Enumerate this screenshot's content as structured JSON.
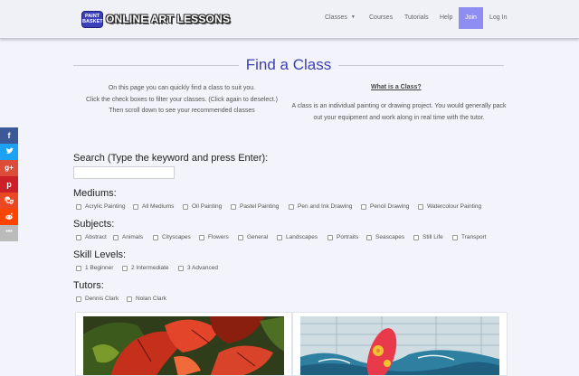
{
  "header": {
    "logo_badge": "PAINT BASKET",
    "logo_text": "ONLINE ART LESSONS",
    "nav": {
      "classes": "Classes",
      "courses": "Courses",
      "tutorials": "Tutorials",
      "help": "Help",
      "join": "Join",
      "login": "Log In"
    }
  },
  "social": [
    {
      "icon": "facebook-icon",
      "glyph": "f",
      "color": "#3b5998"
    },
    {
      "icon": "twitter-icon",
      "glyph": "t",
      "color": "#1da1f2"
    },
    {
      "icon": "google-plus-icon",
      "glyph": "g+",
      "color": "#dd4b39"
    },
    {
      "icon": "pinterest-icon",
      "glyph": "p",
      "color": "#cb2027"
    },
    {
      "icon": "stumbleupon-icon",
      "glyph": "su",
      "color": "#eb4924"
    },
    {
      "icon": "reddit-icon",
      "glyph": "r",
      "color": "#ff4500"
    },
    {
      "icon": "more-icon",
      "glyph": "•••",
      "color": "#bbbbbb"
    }
  ],
  "page": {
    "title": "Find a Class",
    "intro": [
      "On this page you can quickly find a class to suit you.",
      "Click the check boxes to filter your classes.  (Click again to deselect.)",
      "Then scroll down to see your recommended classes"
    ],
    "what_title": "What is a Class?",
    "what_body": "A class is an individual painting or drawing project. You would generally pack out your equipment and work along in real time with the tutor."
  },
  "search": {
    "label": "Search (Type the keyword and press Enter):",
    "value": "",
    "placeholder": ""
  },
  "filters": {
    "mediums": {
      "label": "Mediums:",
      "options": [
        "Acrylic Painting",
        "All Mediums",
        "Oil Painting",
        "Pastel Painting",
        "Pen and Ink Drawing",
        "Pencil Drawing",
        "Watercolour Painting"
      ]
    },
    "subjects": {
      "label": "Subjects:",
      "options": [
        "Abstract",
        "Animals",
        "Cityscapes",
        "Flowers",
        "General",
        "Landscapes",
        "Portraits",
        "Seascapes",
        "Still Life",
        "Transport"
      ]
    },
    "skill_levels": {
      "label": "Skill Levels:",
      "options": [
        "1 Beginner",
        "2 Intermediate",
        "3 Advanced"
      ]
    },
    "tutors": {
      "label": "Tutors:",
      "options": [
        "Dennis Clark",
        "Nolan Clark"
      ]
    }
  },
  "colors": {
    "brand": "#3d40b5",
    "join": "#8e8ef2",
    "background": "#f3f3fb"
  }
}
